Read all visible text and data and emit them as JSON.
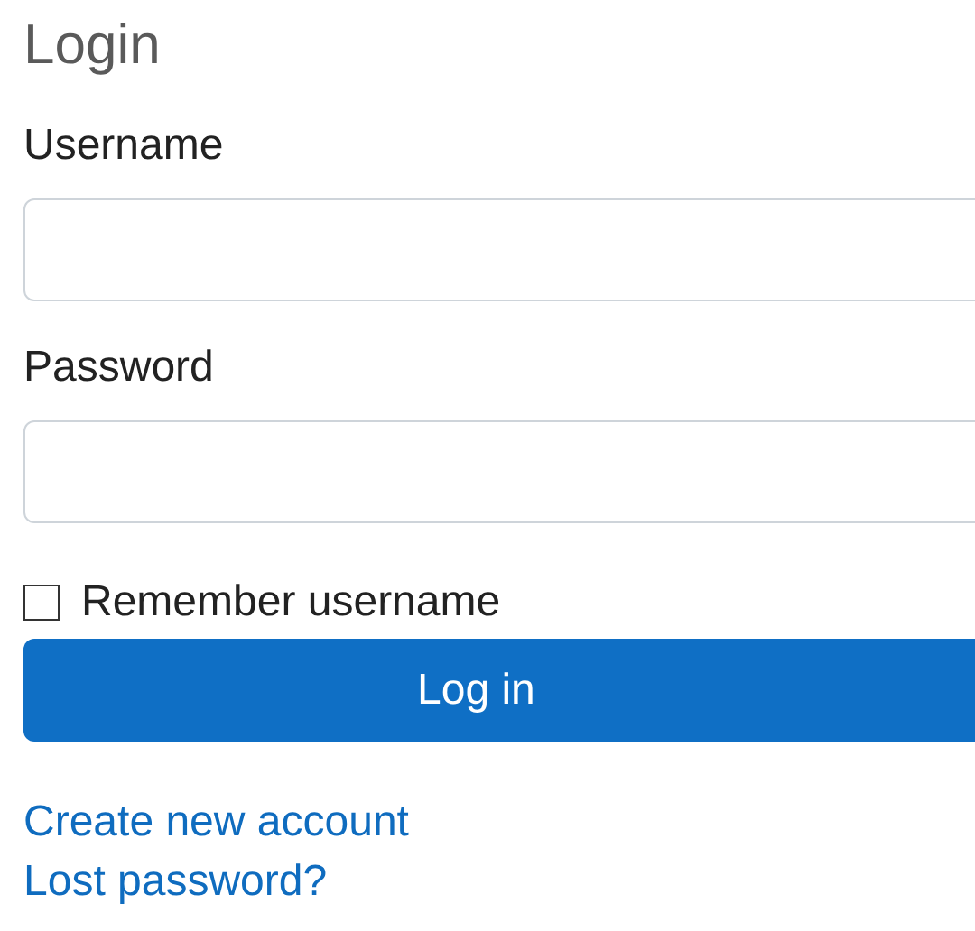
{
  "title": "Login",
  "fields": [
    {
      "label": "Username"
    },
    {
      "label": "Password"
    }
  ],
  "remember": {
    "label": "Remember username",
    "checked": false
  },
  "submit": "Log in",
  "links": [
    "Create new account",
    "Lost password?"
  ]
}
